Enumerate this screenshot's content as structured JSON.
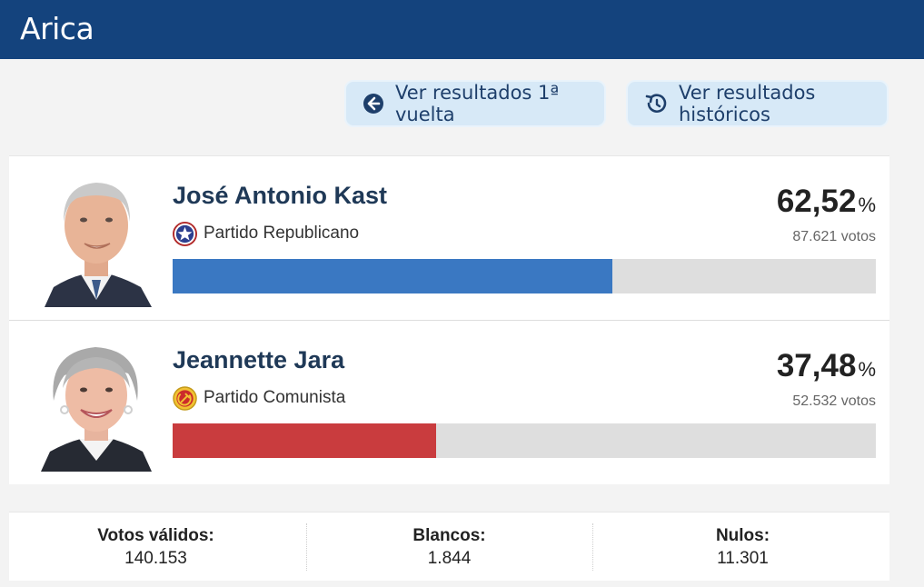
{
  "header": {
    "title": "Arica"
  },
  "buttons": {
    "first_round": {
      "label": "Ver resultados 1ª vuelta",
      "icon": "arrow-left-circle-icon"
    },
    "historic": {
      "label": "Ver resultados históricos",
      "icon": "history-icon"
    }
  },
  "colors": {
    "header_bg": "#14437d",
    "button_bg": "#d7e9f7",
    "kast_bar": "#3a78c2",
    "jara_bar": "#c93c3e",
    "bar_track": "#dedede"
  },
  "candidates": [
    {
      "name": "José Antonio Kast",
      "party": "Partido Republicano",
      "party_icon": "star-emblem-icon",
      "percentage": "62,52",
      "percent_symbol": "%",
      "votes": "87.621 votos",
      "bar_fraction": 0.6252,
      "bar_color": "#3a78c2"
    },
    {
      "name": "Jeannette Jara",
      "party": "Partido Comunista",
      "party_icon": "hammer-sickle-emblem-icon",
      "percentage": "37,48",
      "percent_symbol": "%",
      "votes": "52.532 votos",
      "bar_fraction": 0.3748,
      "bar_color": "#c93c3e"
    }
  ],
  "summary": [
    {
      "label": "Votos válidos:",
      "value": "140.153"
    },
    {
      "label": "Blancos:",
      "value": "1.844"
    },
    {
      "label": "Nulos:",
      "value": "11.301"
    }
  ]
}
